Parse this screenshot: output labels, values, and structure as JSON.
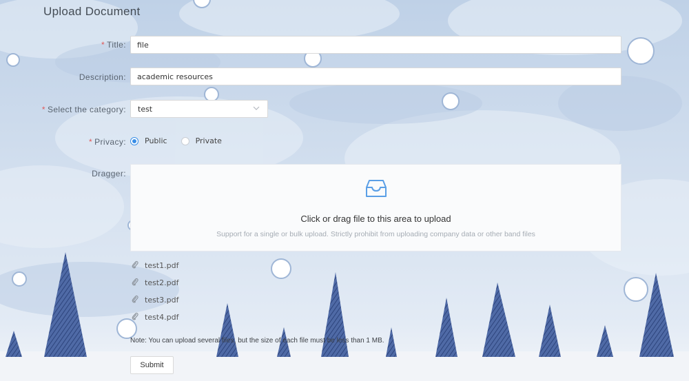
{
  "page": {
    "title": "Upload Document"
  },
  "form": {
    "title": {
      "label": "Title:",
      "value": "file",
      "required": true
    },
    "description": {
      "label": "Description:",
      "value": "academic resources",
      "required": false
    },
    "category": {
      "label": "Select the category:",
      "value": "test",
      "required": true
    },
    "privacy": {
      "label": "Privacy:",
      "required": true,
      "options": [
        {
          "label": "Public",
          "checked": true
        },
        {
          "label": "Private",
          "checked": false
        }
      ]
    },
    "dragger": {
      "label": "Dragger:",
      "main_text": "Click or drag file to this area to upload",
      "hint": "Support for a single or bulk upload. Strictly prohibit from uploading company data or other band files"
    },
    "files": [
      {
        "name": "test1.pdf"
      },
      {
        "name": "test2.pdf"
      },
      {
        "name": "test3.pdf"
      },
      {
        "name": "test4.pdf"
      }
    ],
    "note": "Note: You can upload several files, but the size of each file must be less than 1 MB.",
    "submit_label": "Submit"
  },
  "colors": {
    "accent": "#3a8ee6",
    "required": "#e05a5a",
    "tree": "#4f6aa6"
  },
  "icons": {
    "dragger": "inbox-icon",
    "file": "paperclip-icon",
    "select": "chevron-down-icon"
  }
}
